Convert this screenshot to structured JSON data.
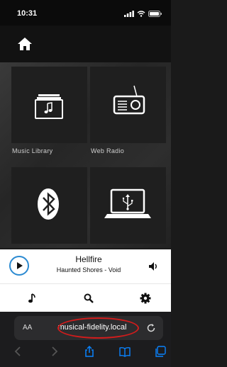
{
  "status_bar": {
    "time": "10:31"
  },
  "app_header": {
    "home_icon": "home-icon"
  },
  "tiles": [
    {
      "label": "Music Library",
      "icon": "music-library-icon"
    },
    {
      "label": "Web Radio",
      "icon": "radio-icon"
    },
    {
      "label": "",
      "icon": "bluetooth-icon"
    },
    {
      "label": "",
      "icon": "usb-laptop-icon"
    }
  ],
  "player": {
    "title": "Hellfire",
    "subtitle": "Haunted Shores - Void"
  },
  "nav": [
    "music-note-icon",
    "search-icon",
    "gear-icon"
  ],
  "browser": {
    "text_size": "AA",
    "url": "musical-fidelity.local"
  },
  "colors": {
    "accent": "#2b8ad1",
    "annotation": "#d01c1c",
    "safari_blue": "#0a84ff"
  }
}
